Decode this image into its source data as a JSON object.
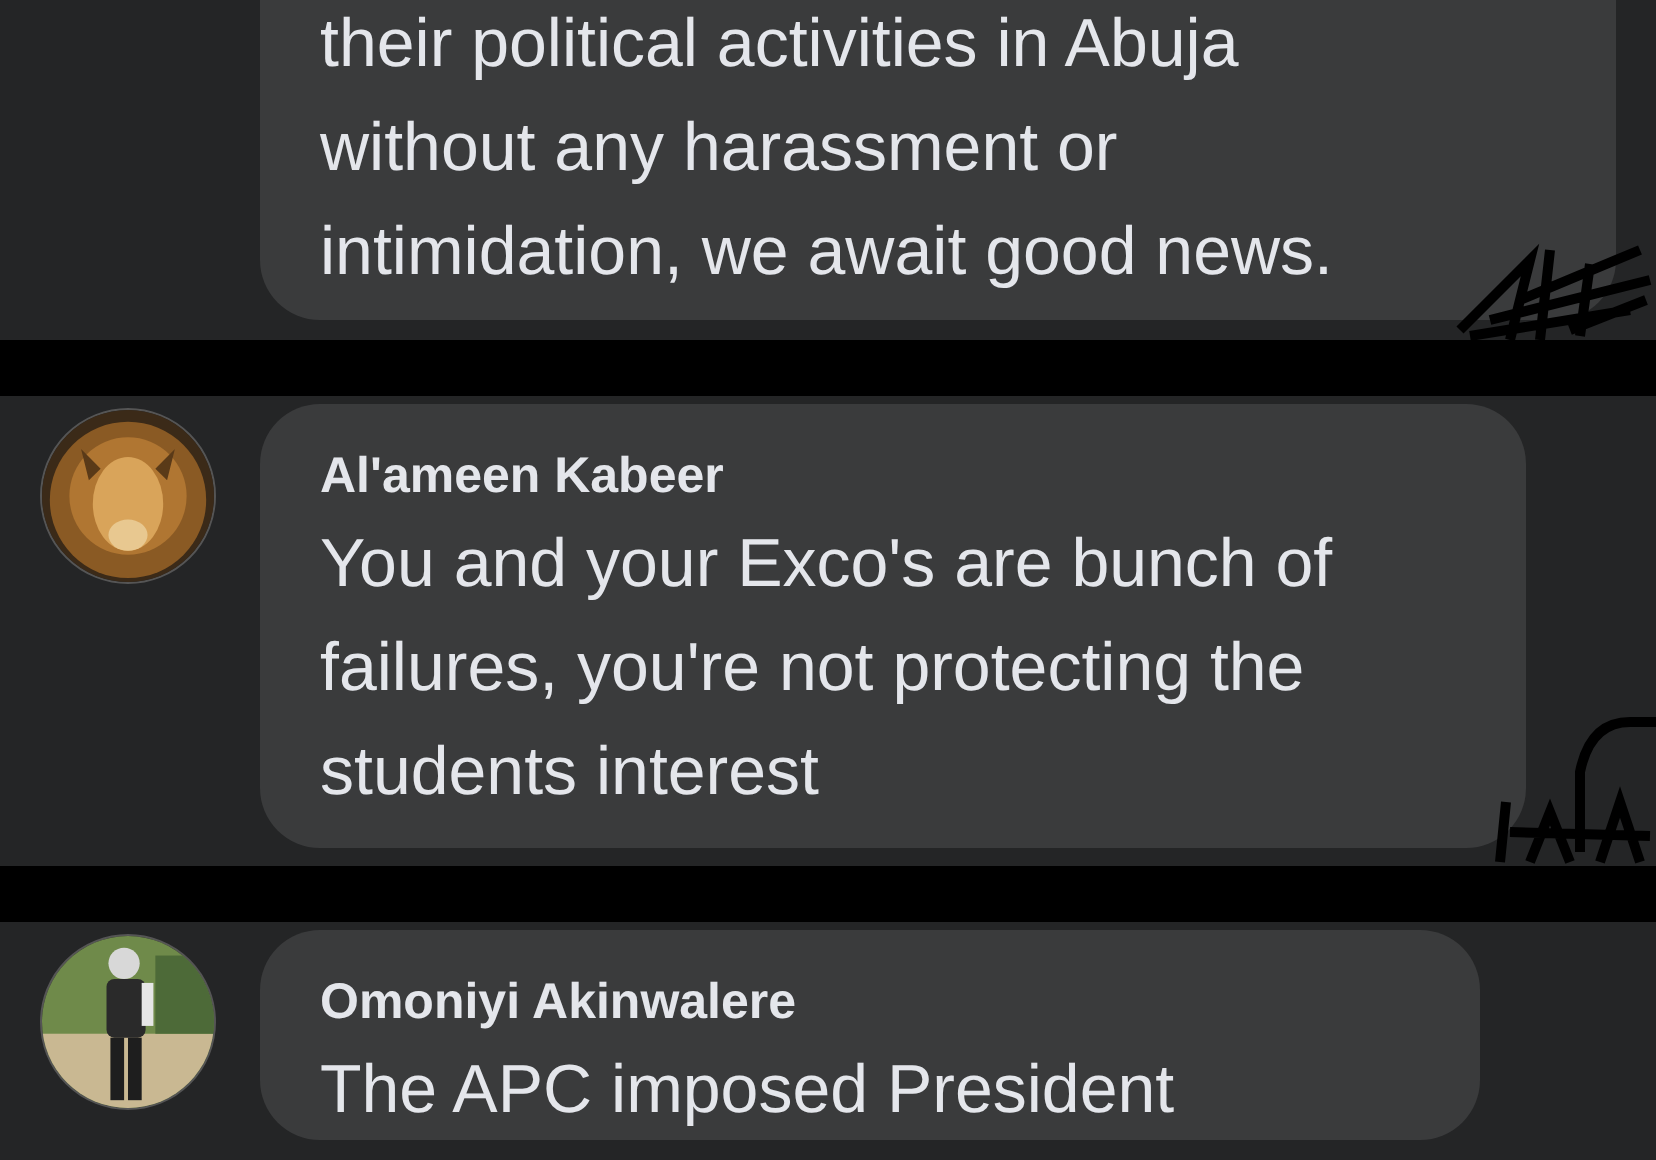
{
  "comments": [
    {
      "text": "their political activities in Abuja\nwithout any harassment or\nintimidation, we await good news.",
      "redacted_time": true
    },
    {
      "author": "Al'ameen Kabeer",
      "text": "You and your Exco's are bunch of\nfailures, you're not protecting the\nstudents interest",
      "redacted_time": true
    },
    {
      "author": "Omoniyi Akinwalere",
      "text": "The APC imposed President"
    }
  ]
}
